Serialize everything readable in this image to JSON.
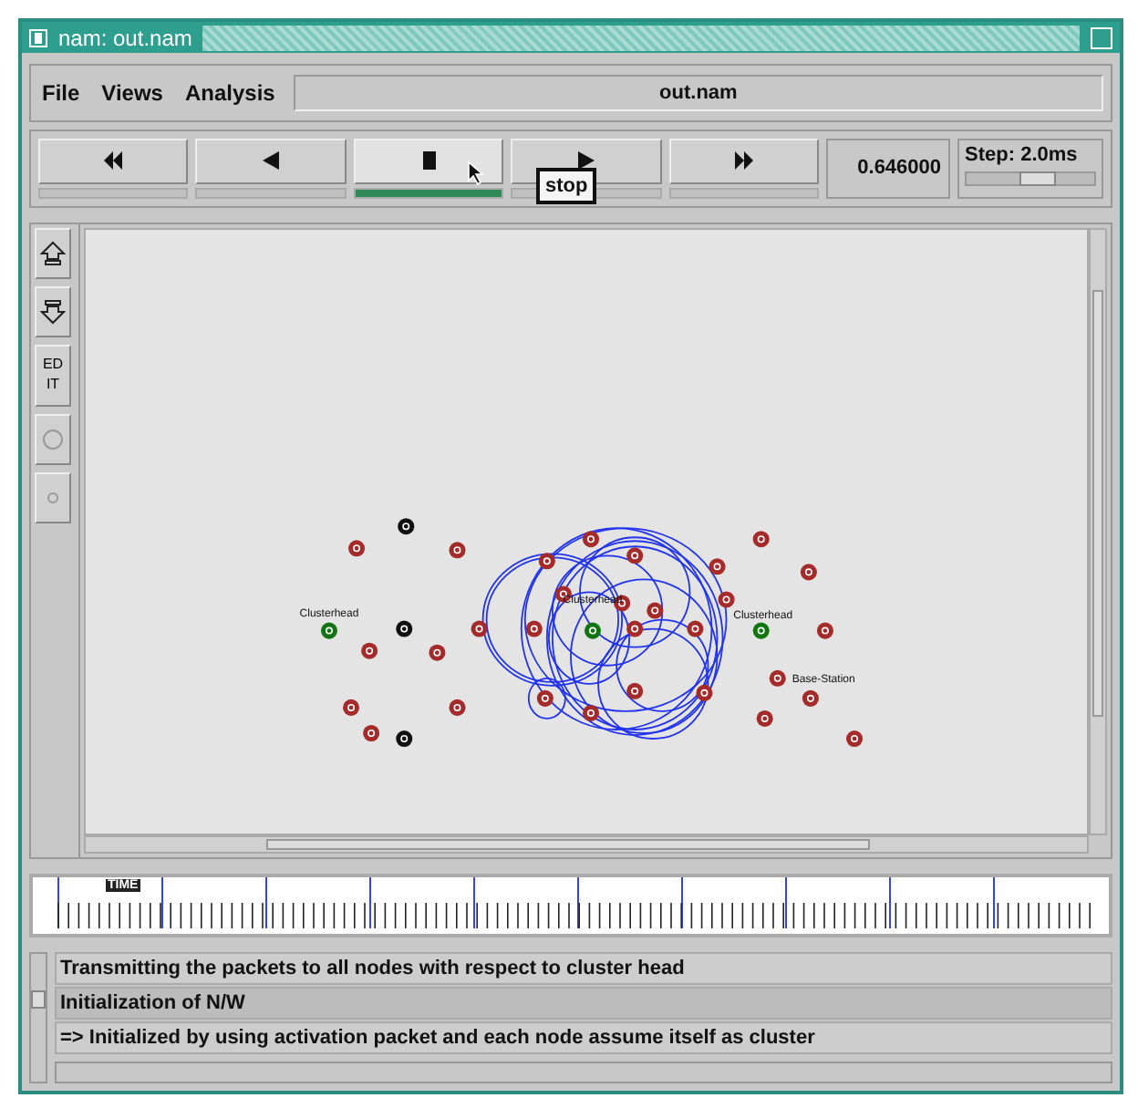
{
  "window": {
    "title": "nam: out.nam"
  },
  "menu": [
    "File",
    "Views",
    "Analysis"
  ],
  "file_name": "out.nam",
  "controls": [
    {
      "kind": "rewind",
      "selected": false
    },
    {
      "kind": "back",
      "selected": false
    },
    {
      "kind": "stop",
      "selected": true
    },
    {
      "kind": "play",
      "selected": false
    },
    {
      "kind": "forward",
      "selected": false
    }
  ],
  "tooltip": "stop",
  "time": "0.646000",
  "step": {
    "label": "Step: 2.0ms",
    "level": 0.55
  },
  "edit_tools": [
    {
      "kind": "up"
    },
    {
      "kind": "down"
    },
    {
      "kind": "text",
      "label": "EDIT"
    },
    {
      "kind": "circle"
    },
    {
      "kind": "dot"
    }
  ],
  "network_labels": [
    "Clusterhead",
    "Clusterhead",
    "Clusterhead",
    "Base-Station"
  ],
  "timeline_marker": "TIME",
  "log": [
    {
      "text": "Transmitting the packets to all nodes with respect to cluster head",
      "selected": false
    },
    {
      "text": "Initialization of N/W",
      "selected": true
    },
    {
      "text": "=> Initialized by using activation packet and each node assume itself as cluster",
      "selected": false
    }
  ]
}
